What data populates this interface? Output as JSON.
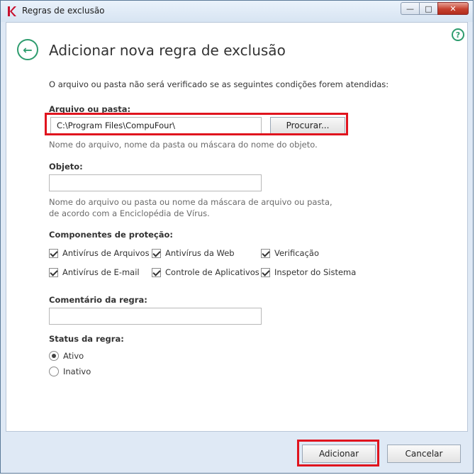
{
  "window": {
    "title": "Regras de exclusão",
    "close_glyph": "✕",
    "minimize_glyph": "—",
    "maximize_glyph": "□"
  },
  "page": {
    "title": "Adicionar nova regra de exclusão",
    "description": "O arquivo ou pasta não será verificado se as seguintes condições forem atendidas:",
    "help_glyph": "?",
    "back_glyph": "←"
  },
  "file_section": {
    "label": "Arquivo ou pasta:",
    "value": "C:\\Program Files\\CompuFour\\",
    "browse_label": "Procurar...",
    "hint": "Nome do arquivo, nome da pasta ou máscara do nome do objeto."
  },
  "object_section": {
    "label": "Objeto:",
    "value": "",
    "hint_line1": "Nome do arquivo ou pasta ou nome da máscara de arquivo ou pasta,",
    "hint_line2": "de acordo com a Enciclopédia de Vírus."
  },
  "components": {
    "label": "Componentes de proteção:",
    "items": [
      {
        "label": "Antivírus de Arquivos",
        "checked": true
      },
      {
        "label": "Antivírus da Web",
        "checked": true
      },
      {
        "label": "Verificação",
        "checked": true
      },
      {
        "label": "Antivírus de E-mail",
        "checked": true
      },
      {
        "label": "Controle de Aplicativos",
        "checked": true
      },
      {
        "label": "Inspetor do Sistema",
        "checked": true
      }
    ]
  },
  "comment_section": {
    "label": "Comentário da regra:",
    "value": ""
  },
  "status_section": {
    "label": "Status da regra:",
    "options": [
      {
        "label": "Ativo",
        "selected": true
      },
      {
        "label": "Inativo",
        "selected": false
      }
    ]
  },
  "footer": {
    "add_label": "Adicionar",
    "cancel_label": "Cancelar"
  },
  "colors": {
    "accent": "#2e9c6e",
    "highlight": "#e0141e"
  }
}
